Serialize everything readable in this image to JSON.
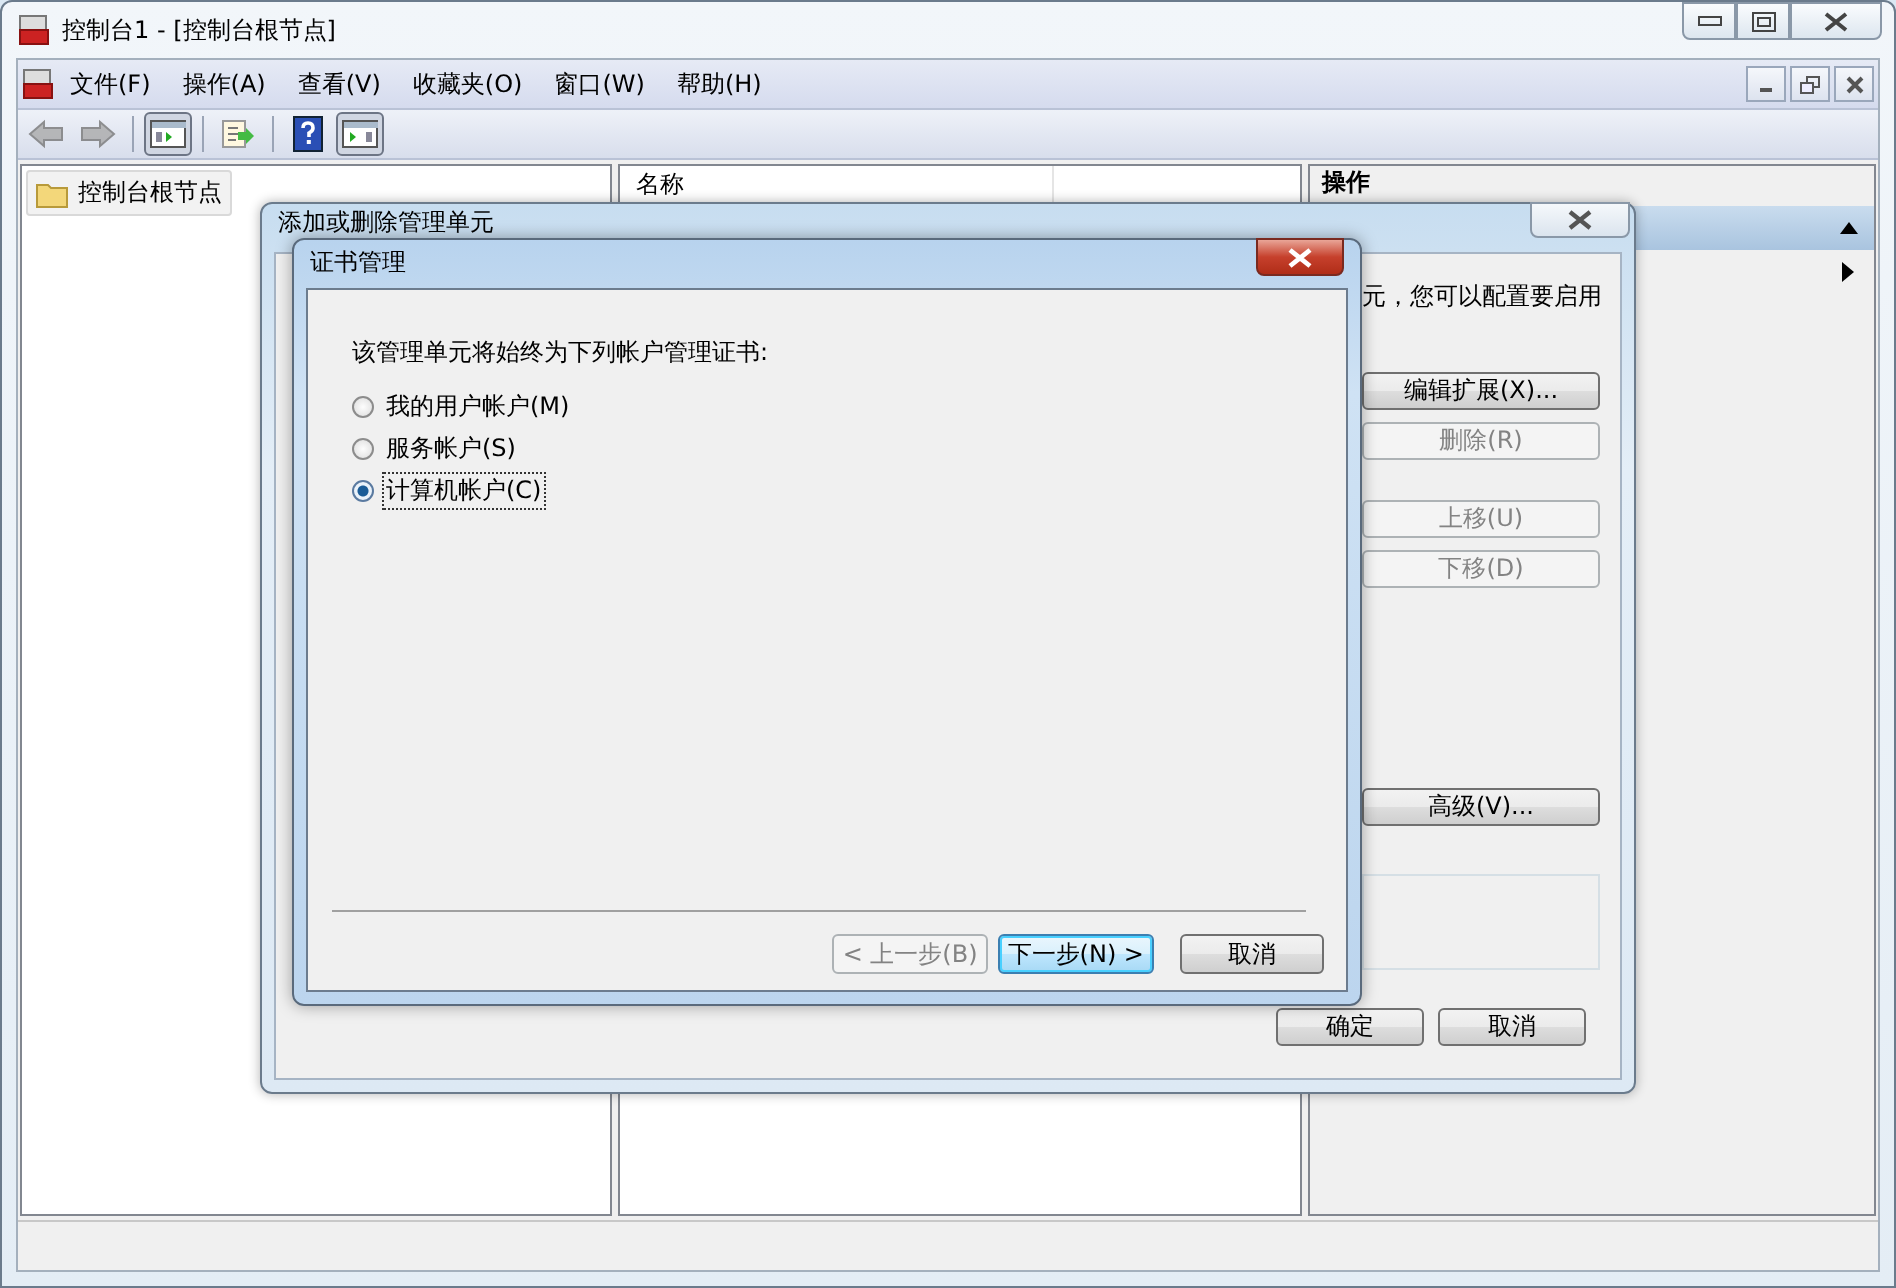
{
  "window": {
    "title": "控制台1 - [控制台根节点]"
  },
  "menu": [
    "文件(F)",
    "操作(A)",
    "查看(V)",
    "收藏夹(O)",
    "窗口(W)",
    "帮助(H)"
  ],
  "toolbar": [
    {
      "kind": "back",
      "pressed": false,
      "disabled": true
    },
    {
      "kind": "forward",
      "pressed": false,
      "disabled": true
    },
    {
      "kind": "tree-toggle",
      "pressed": true,
      "disabled": false
    },
    {
      "kind": "export",
      "pressed": false,
      "disabled": false
    },
    {
      "kind": "help",
      "pressed": false,
      "disabled": false
    },
    {
      "kind": "action-toggle",
      "pressed": true,
      "disabled": false
    }
  ],
  "tree": {
    "items": [
      {
        "label": "控制台根节点",
        "selected": true
      }
    ]
  },
  "list": {
    "columns": [
      "名称"
    ]
  },
  "actions_pane": {
    "title": "操作"
  },
  "snapin_dialog": {
    "title": "添加或删除管理单元",
    "description": "元，您可以配置要启用",
    "buttons": [
      {
        "label": "编辑扩展(X)...",
        "disabled": false
      },
      {
        "label": "删除(R)",
        "disabled": true
      },
      {
        "label": "上移(U)",
        "disabled": true
      },
      {
        "label": "下移(D)",
        "disabled": true
      },
      {
        "label": "高级(V)...",
        "disabled": false
      }
    ],
    "footer_buttons": [
      "确定",
      "取消"
    ]
  },
  "cert_dialog": {
    "title": "证书管理",
    "prompt": "该管理单元将始终为下列帐户管理证书:",
    "options": [
      {
        "label": "我的用户帐户(M)",
        "selected": false
      },
      {
        "label": "服务帐户(S)",
        "selected": false
      },
      {
        "label": "计算机帐户(C)",
        "selected": true
      }
    ],
    "buttons": [
      {
        "label": "< 上一步(B)",
        "disabled": true,
        "default": false
      },
      {
        "label": "下一步(N) >",
        "disabled": false,
        "default": true
      },
      {
        "label": "取消",
        "disabled": false,
        "default": false
      }
    ]
  }
}
